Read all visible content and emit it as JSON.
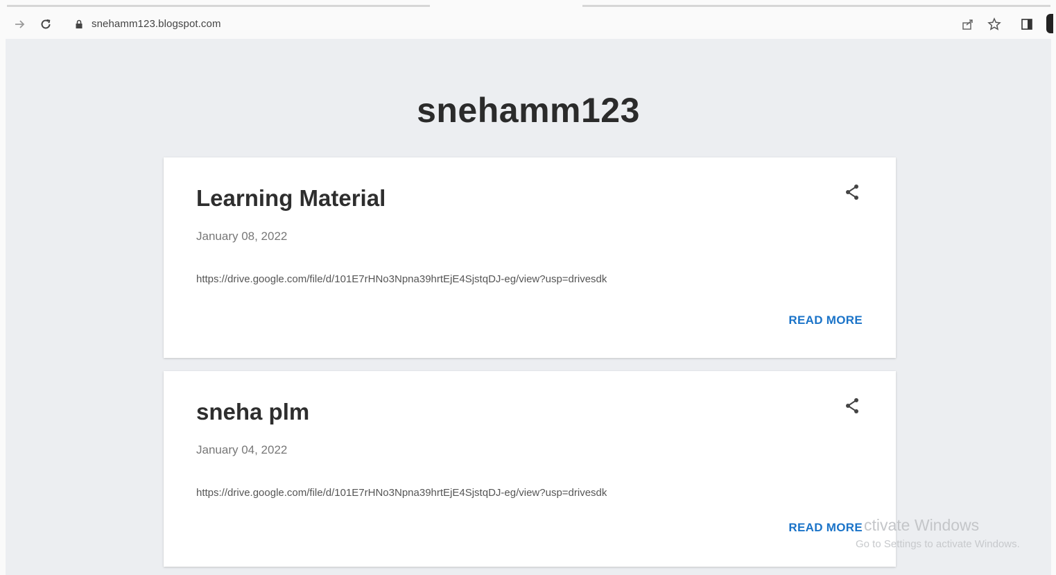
{
  "browser": {
    "url": "snehamm123.blogspot.com",
    "icons": [
      "back-arrow-icon",
      "reload-icon",
      "lock-icon",
      "share-page-icon",
      "star-icon",
      "side-panel-icon",
      "profile-avatar"
    ]
  },
  "blog": {
    "title": "snehamm123"
  },
  "posts": [
    {
      "title": "Learning Material",
      "date": "January 08, 2022",
      "snippet": "https://drive.google.com/file/d/101E7rHNo3Npna39hrtEjE4SjstqDJ-eg/view?usp=drivesdk",
      "read_more": "READ MORE"
    },
    {
      "title": "sneha plm",
      "date": "January 04, 2022",
      "snippet": "https://drive.google.com/file/d/101E7rHNo3Npna39hrtEjE4SjstqDJ-eg/view?usp=drivesdk",
      "read_more": "READ MORE"
    }
  ],
  "watermark": {
    "line1": "ctivate Windows",
    "line2": "Go to Settings to activate Windows."
  },
  "colors": {
    "accent": "#1a73c8",
    "page_bg": "#eceef1",
    "card_bg": "#ffffff"
  }
}
